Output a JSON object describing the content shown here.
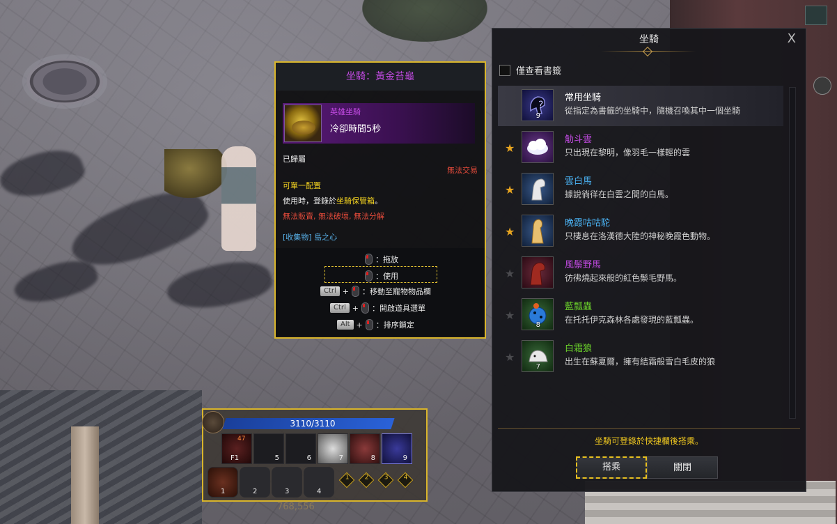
{
  "tooltip": {
    "title": "坐騎：黃金苔龜",
    "grade": "英雄坐騎",
    "cooldown": "冷卻時間5秒",
    "bound": "已歸屬",
    "no_trade": "無法交易",
    "equip": "可單一配置",
    "use_desc_prefix": "使用時，登錄於",
    "use_desc_highlight": "坐騎保管箱",
    "use_desc_suffix": "。",
    "restrictions": [
      "無法販賣",
      "無法破壞",
      "無法分解"
    ],
    "collection": "[收集物] 島之心",
    "keys": {
      "drag": "：拖放",
      "use": "：使用",
      "ctrl": "Ctrl",
      "move_pet": "：移動至寵物物品欄",
      "open_menu": "：開啟道具選單",
      "alt": "Alt",
      "lock_sort": "：排序鎖定"
    },
    "gold_behind": "768,556"
  },
  "mount_window": {
    "title": "坐騎",
    "close_label": "X",
    "bookmark_label": "僅查看書籤",
    "rows": [
      {
        "name": "常用坐騎",
        "desc": "從指定為書籤的坐騎中，隨機召喚其中一個坐騎",
        "name_color": "white",
        "starred": null,
        "icon": "random-mount-icon",
        "num": "9"
      },
      {
        "name": "觔斗雲",
        "desc": "只出現在黎明，像羽毛一樣輕的雲",
        "name_color": "purple",
        "starred": true,
        "icon": "cloud-icon",
        "num": ""
      },
      {
        "name": "雲白馬",
        "desc": "據說徜徉在白雲之間的白馬。",
        "name_color": "blue",
        "starred": true,
        "icon": "white-horse-icon",
        "num": ""
      },
      {
        "name": "晚霞咕咕駝",
        "desc": "只棲息在洛漢德大陸的神秘晚霞色動物。",
        "name_color": "blue",
        "starred": true,
        "icon": "alpaca-icon",
        "num": ""
      },
      {
        "name": "風鬃野馬",
        "desc": "彷彿燒起來般的紅色鬃毛野馬。",
        "name_color": "purple",
        "starred": false,
        "icon": "red-horse-icon",
        "num": ""
      },
      {
        "name": "藍瓢蟲",
        "desc": "在托托伊克森林各處發現的藍瓢蟲。",
        "name_color": "green",
        "starred": false,
        "icon": "blue-ladybug-icon",
        "num": "8"
      },
      {
        "name": "白霜狼",
        "desc": "出生在蘇夏爾，擁有結霜般雪白毛皮的狼",
        "name_color": "green",
        "starred": false,
        "icon": "white-wolf-icon",
        "num": "7"
      }
    ],
    "note": "坐騎可登錄於快捷欄後搭乘。",
    "ride_button": "搭乘",
    "close_button": "關閉"
  },
  "hotbar": {
    "hp": "3110/3110",
    "top_slots": [
      "F1",
      "5",
      "6",
      "7",
      "8",
      "9"
    ],
    "bottom_slots": [
      "1",
      "2",
      "3",
      "4"
    ],
    "diamonds": [
      "1",
      "2",
      "3",
      "4"
    ],
    "potion_count": "47"
  },
  "colors": {
    "accent_gold": "#d9b52b",
    "hero_purple": "#c04ae0",
    "rare_blue": "#4ab0f0",
    "uncommon_green": "#6ad02a",
    "note_yellow": "#f0c820",
    "restriction_red": "#e24a3a"
  }
}
